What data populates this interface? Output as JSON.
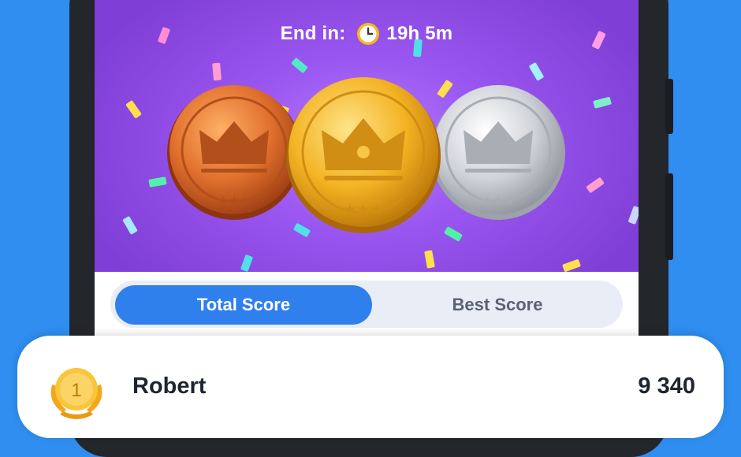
{
  "banner": {
    "end_label": "End in:",
    "time_left": "19h 5m",
    "icons": [
      "clock-icon",
      "bronze-medal",
      "gold-medal",
      "silver-medal",
      "confetti"
    ]
  },
  "tabs": [
    {
      "label": "Total Score",
      "active": true
    },
    {
      "label": "Best Score",
      "active": false
    }
  ],
  "current_user": {
    "rank": "1",
    "name": "Robert",
    "score": "9 340"
  },
  "colors": {
    "background": "#2f8ef0",
    "banner": "#9a56f0",
    "active_tab": "#2f80ed",
    "gold": "#f4b928",
    "bronze": "#d9692b",
    "silver": "#c9ccd2"
  }
}
